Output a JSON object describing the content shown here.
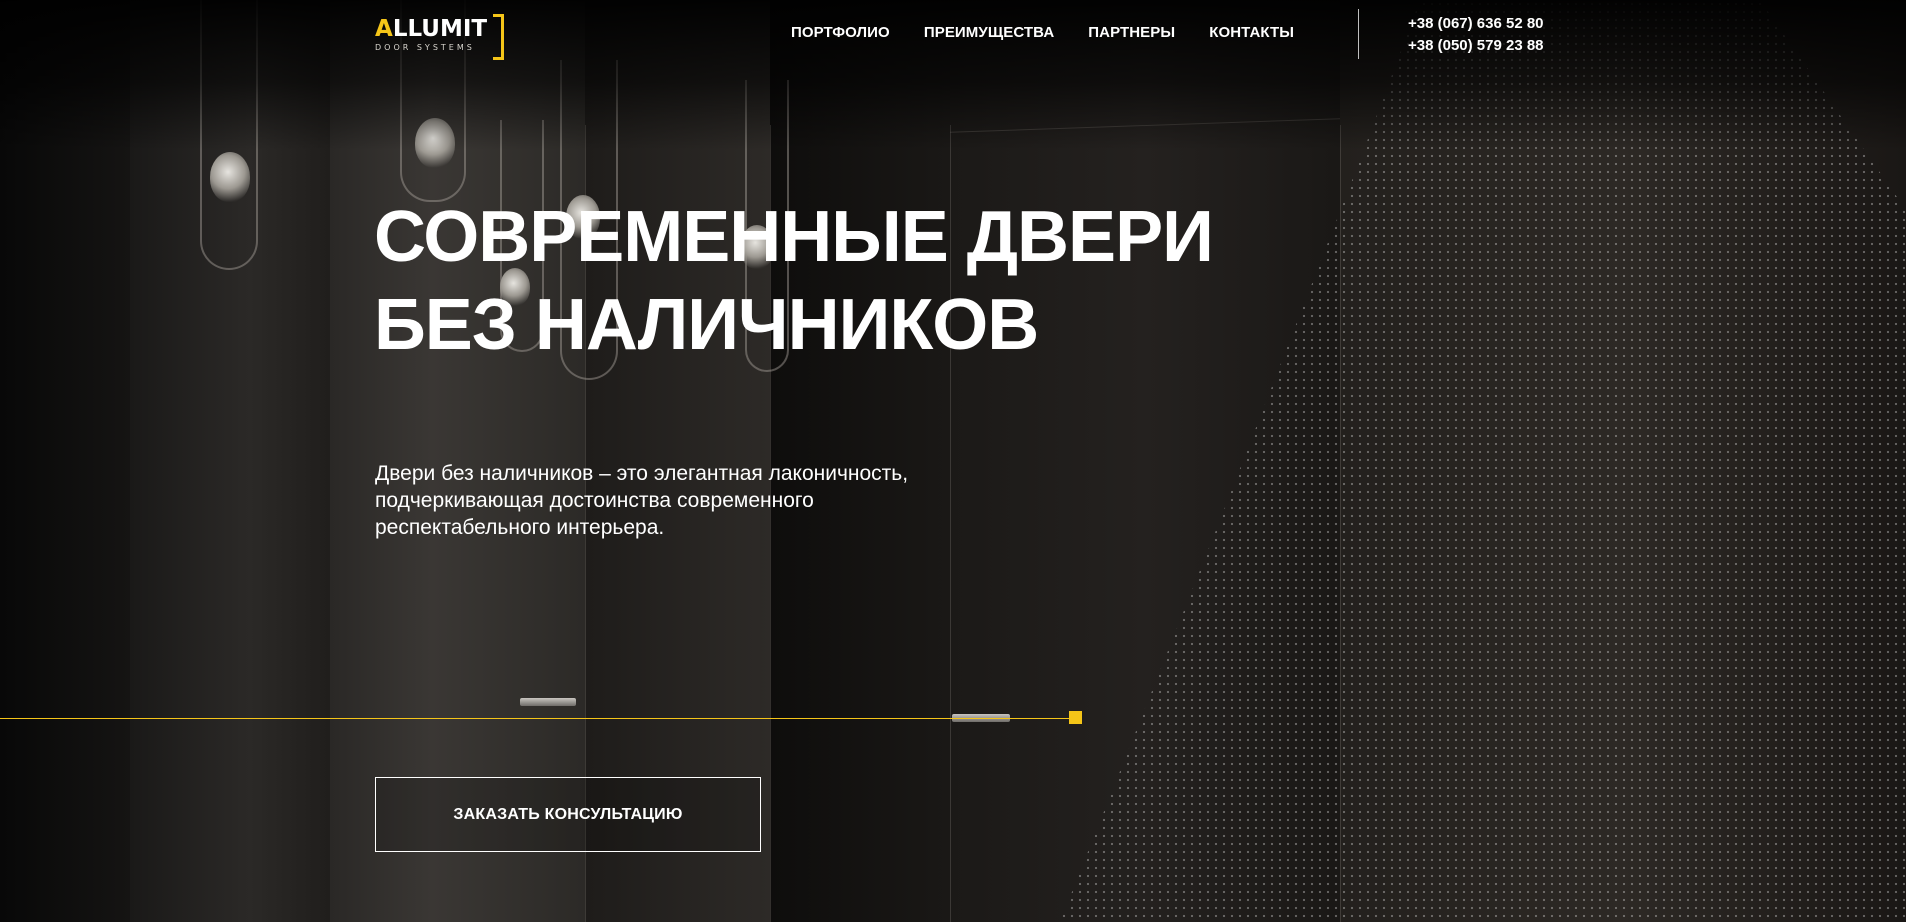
{
  "header": {
    "logo": {
      "brand_first_letter": "A",
      "brand_rest": "LLUMIT",
      "tagline": "DOOR SYSTEMS"
    },
    "nav": [
      {
        "label": "ПОРТФОЛИО"
      },
      {
        "label": "ПРЕИМУЩЕСТВА"
      },
      {
        "label": "ПАРТНЕРЫ"
      },
      {
        "label": "КОНТАКТЫ"
      }
    ],
    "phones": [
      "+38 (067) 636 52 80",
      "+38 (050) 579 23 88"
    ]
  },
  "hero": {
    "title_line1": "СОВРЕМЕННЫЕ ДВЕРИ",
    "title_line2": "БЕЗ НАЛИЧНИКОВ",
    "description": "Двери без наличников – это элегантная лаконичность, подчеркивающая достоинства современного респектабельного интерьера.",
    "cta_label": "ЗАКАЗАТЬ КОНСУЛЬТАЦИЮ"
  },
  "colors": {
    "accent": "#f5c518",
    "text": "#ffffff",
    "background": "#0a0908"
  }
}
